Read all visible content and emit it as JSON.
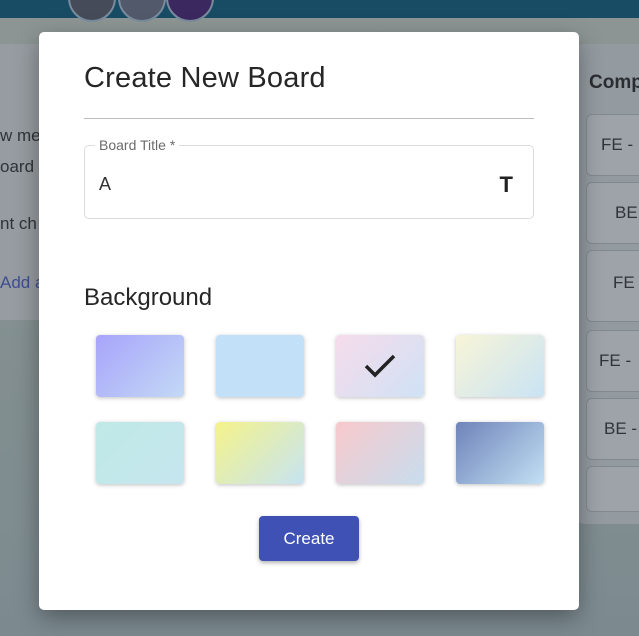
{
  "background_board": {
    "left_column_fragments": [
      "w me",
      "oard",
      "nt ch",
      "Add a"
    ],
    "right_column": {
      "title": "Comp",
      "cards": [
        "FE -",
        "BE",
        "FE",
        "FE -",
        "BE -",
        ""
      ]
    }
  },
  "modal": {
    "title": "Create New Board",
    "board_title_field": {
      "label": "Board Title *",
      "value": "A",
      "icon": "text-format-icon",
      "icon_glyph": "T"
    },
    "background_section_title": "Background",
    "backgrounds": [
      {
        "name": "lavender-gradient",
        "colors": [
          "#a8a4fb",
          "#c3d9f5"
        ],
        "selected": false
      },
      {
        "name": "light-blue",
        "colors": [
          "#c2e0f7",
          "#c2e0f7"
        ],
        "selected": false
      },
      {
        "name": "pink-blue-gradient",
        "colors": [
          "#f6dceb",
          "#cfe2f5"
        ],
        "selected": true
      },
      {
        "name": "cream-blue-gradient",
        "colors": [
          "#f8f5d8",
          "#c9e3f4"
        ],
        "selected": false
      },
      {
        "name": "mint",
        "colors": [
          "#bfe9e6",
          "#c6e6ef"
        ],
        "selected": false
      },
      {
        "name": "yellow-blue-gradient",
        "colors": [
          "#f5f38a",
          "#c6e4f2"
        ],
        "selected": false
      },
      {
        "name": "peach-blue-gradient",
        "colors": [
          "#f8c9cb",
          "#c8ddee"
        ],
        "selected": false
      },
      {
        "name": "indigo-sky-gradient",
        "colors": [
          "#6f83b9",
          "#c2e0f4"
        ],
        "selected": false
      }
    ],
    "create_button": "Create",
    "accent_color": "#3f51b5"
  }
}
